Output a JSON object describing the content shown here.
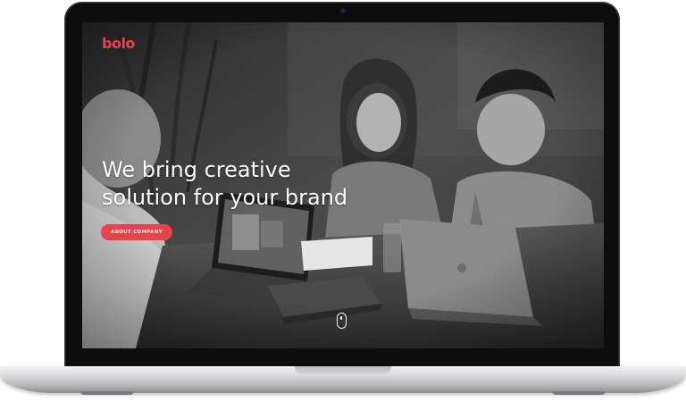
{
  "site": {
    "logo": "bolo",
    "headline_line1": "We bring creative",
    "headline_line2": "solution for your brand",
    "cta_label": "ABOUT COMPANY"
  },
  "hero_image": {
    "description_icon": "photo-of-people-at-table-with-laptops",
    "style": "grayscale"
  },
  "scroll_indicator": {
    "icon": "mouse-scroll-icon"
  },
  "colors": {
    "accent": "#e8434c",
    "headline_text": "#ffffff",
    "bezel": "#0d0d0e",
    "body_silver": "#d9d9db"
  }
}
